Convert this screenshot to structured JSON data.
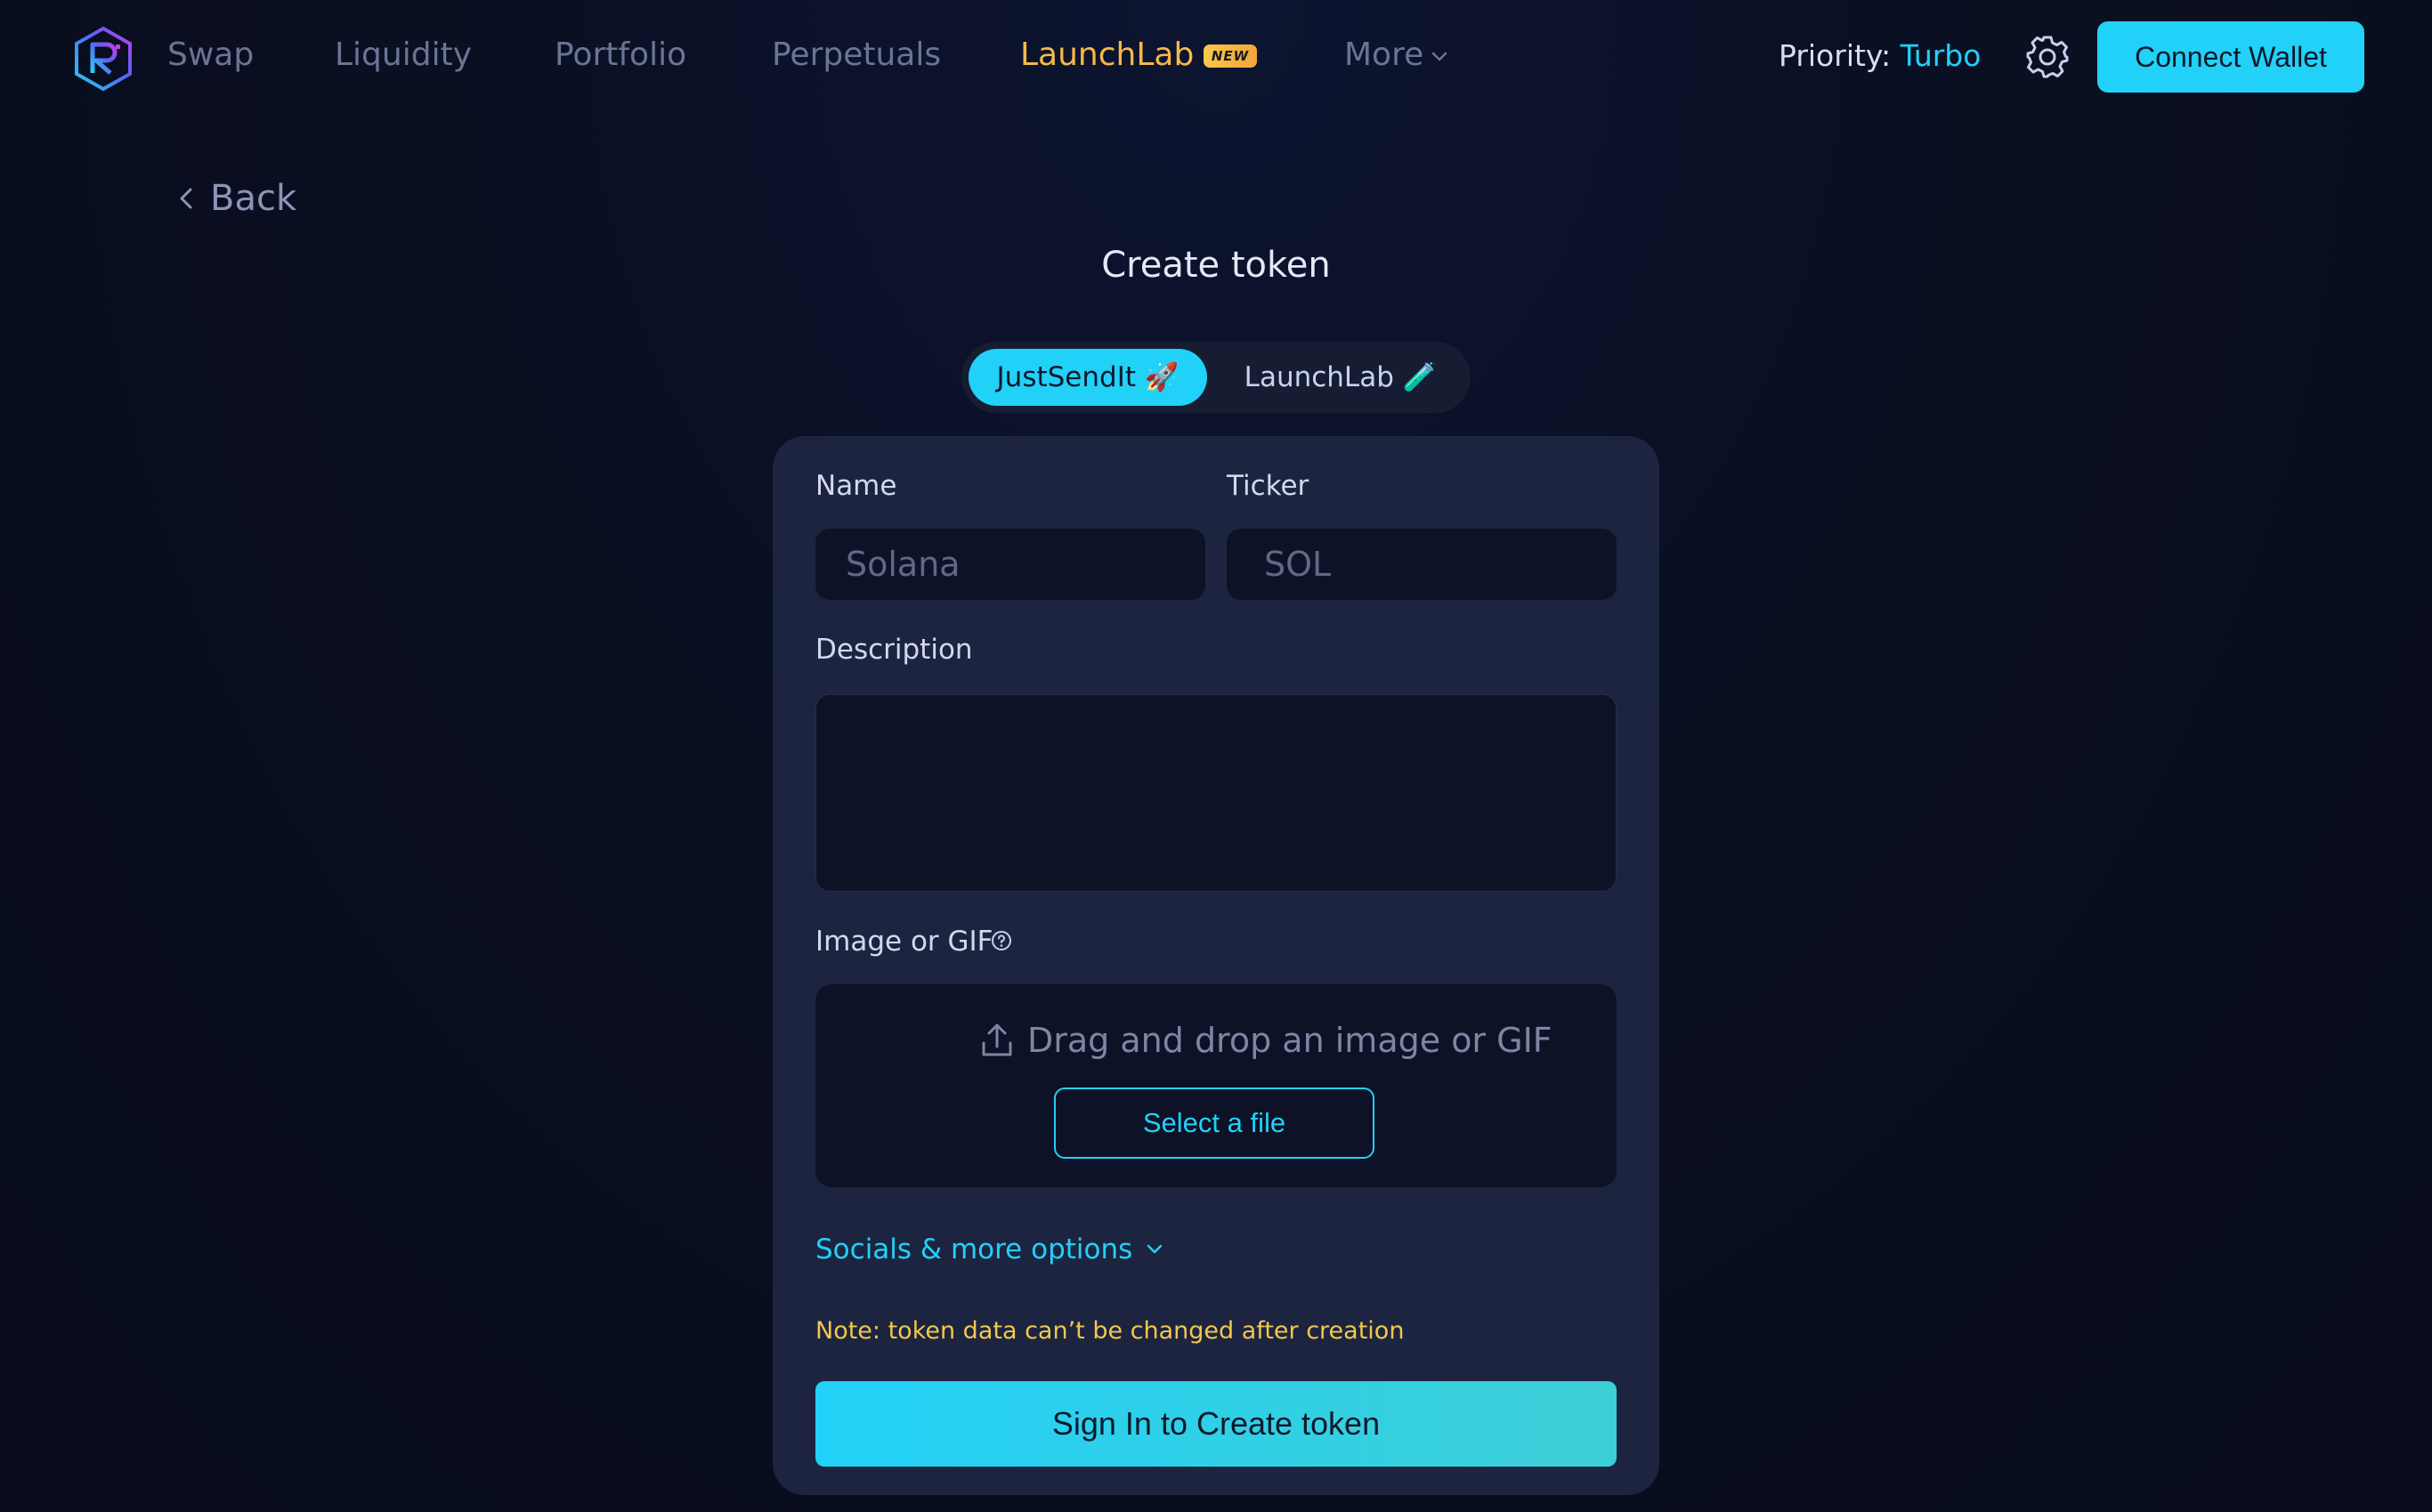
{
  "nav": {
    "items": [
      {
        "label": "Swap"
      },
      {
        "label": "Liquidity"
      },
      {
        "label": "Portfolio"
      },
      {
        "label": "Perpetuals"
      },
      {
        "label": "LaunchLab",
        "badge": "NEW"
      },
      {
        "label": "More"
      }
    ],
    "priority_label": "Priority:",
    "priority_value": "Turbo",
    "connect_wallet": "Connect Wallet"
  },
  "back_label": "Back",
  "page_title": "Create token",
  "mode_toggle": {
    "options": [
      {
        "label": "JustSendIt 🚀",
        "active": true
      },
      {
        "label": "LaunchLab 🧪",
        "active": false
      }
    ]
  },
  "form": {
    "name": {
      "label": "Name",
      "value": "",
      "placeholder": "Solana"
    },
    "ticker": {
      "label": "Ticker",
      "value": "",
      "placeholder": "SOL"
    },
    "description": {
      "label": "Description",
      "value": ""
    },
    "image": {
      "label": "Image or GIF",
      "drop_text": "Drag and drop an image or GIF",
      "select_file": "Select a file"
    },
    "socials_toggle": "Socials & more options",
    "note": "Note: token data can’t be changed after creation",
    "submit": "Sign In to Create token"
  },
  "colors": {
    "accent": "#22d1f8",
    "launchlab": "#f5b947",
    "note": "#f2c84b",
    "card": "#1c2440",
    "input_bg": "#0d1226",
    "background": "#0a0f22"
  },
  "icons": [
    "raydium-logo",
    "chevron-down-icon",
    "gear-icon",
    "chevron-left-icon",
    "help-circle-icon",
    "upload-icon"
  ]
}
